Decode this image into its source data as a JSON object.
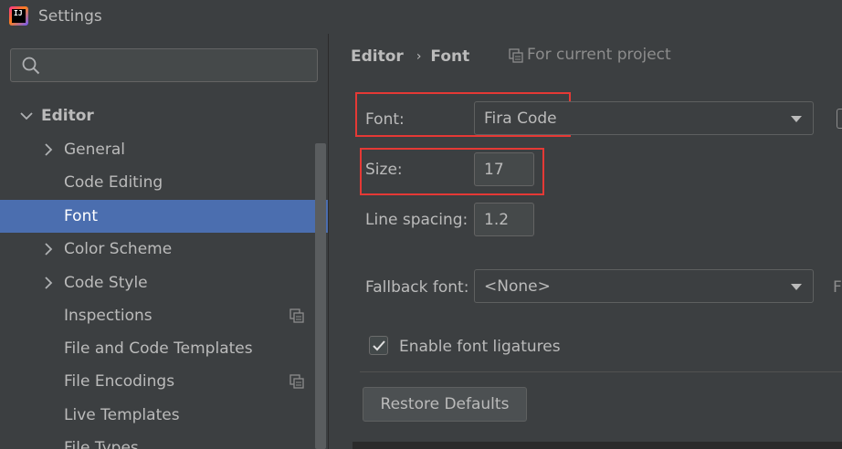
{
  "window": {
    "title": "Settings"
  },
  "sidebar": {
    "search": {
      "placeholder": "",
      "value": ""
    },
    "items": [
      {
        "label": "Editor",
        "level": 0,
        "expanded": true
      },
      {
        "label": "General",
        "level": 1,
        "expandable": true
      },
      {
        "label": "Code Editing",
        "level": 1
      },
      {
        "label": "Font",
        "level": 1,
        "selected": true
      },
      {
        "label": "Color Scheme",
        "level": 1,
        "expandable": true
      },
      {
        "label": "Code Style",
        "level": 1,
        "expandable": true
      },
      {
        "label": "Inspections",
        "level": 1,
        "project_icon": true
      },
      {
        "label": "File and Code Templates",
        "level": 1
      },
      {
        "label": "File Encodings",
        "level": 1,
        "project_icon": true
      },
      {
        "label": "Live Templates",
        "level": 1
      },
      {
        "label": "File Types",
        "level": 1
      }
    ]
  },
  "breadcrumb": {
    "parent": "Editor",
    "current": "Font",
    "scope": "For current project"
  },
  "form": {
    "font_label": "Font:",
    "font_value": "Fira Code",
    "size_label": "Size:",
    "size_value": "17",
    "line_spacing_label": "Line spacing:",
    "line_spacing_value": "1.2",
    "fallback_label": "Fallback font:",
    "fallback_value": "<None>",
    "ligatures_label": "Enable font ligatures",
    "ligatures_checked": true,
    "edge_letter": "F"
  },
  "buttons": {
    "restore": "Restore Defaults"
  },
  "colors": {
    "selection": "#4b6eaf",
    "highlight": "#e53935",
    "background": "#3c3f41"
  }
}
